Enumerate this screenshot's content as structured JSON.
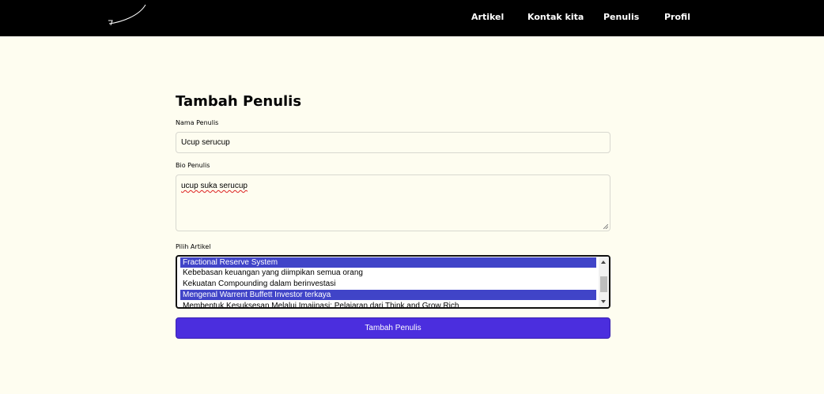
{
  "nav": {
    "links": [
      "Artikel",
      "Kontak kita",
      "Penulis",
      "Profil"
    ]
  },
  "form": {
    "title": "Tambah Penulis",
    "name_label": "Nama Penulis",
    "name_value": "Ucup serucup",
    "bio_label": "Bio Penulis",
    "bio_value": "ucup suka serucup",
    "article_label": "Pilih Artikel",
    "articles": [
      {
        "label": "Fractional Reserve System",
        "selected": true
      },
      {
        "label": "Kebebasan keuangan yang diimpikan semua orang",
        "selected": false
      },
      {
        "label": "Kekuatan Compounding dalam berinvestasi",
        "selected": false
      },
      {
        "label": "Mengenal Warrent Buffett Investor terkaya",
        "selected": true
      },
      {
        "label": "Membentuk Kesuksesan Melalui Imajinasi: Pelajaran dari Think and Grow Rich",
        "selected": false
      }
    ],
    "submit_label": "Tambah Penulis"
  },
  "colors": {
    "navbar": "#000000",
    "background": "#fefdf0",
    "button": "#4b2ede",
    "selected_option": "#4044c8"
  }
}
